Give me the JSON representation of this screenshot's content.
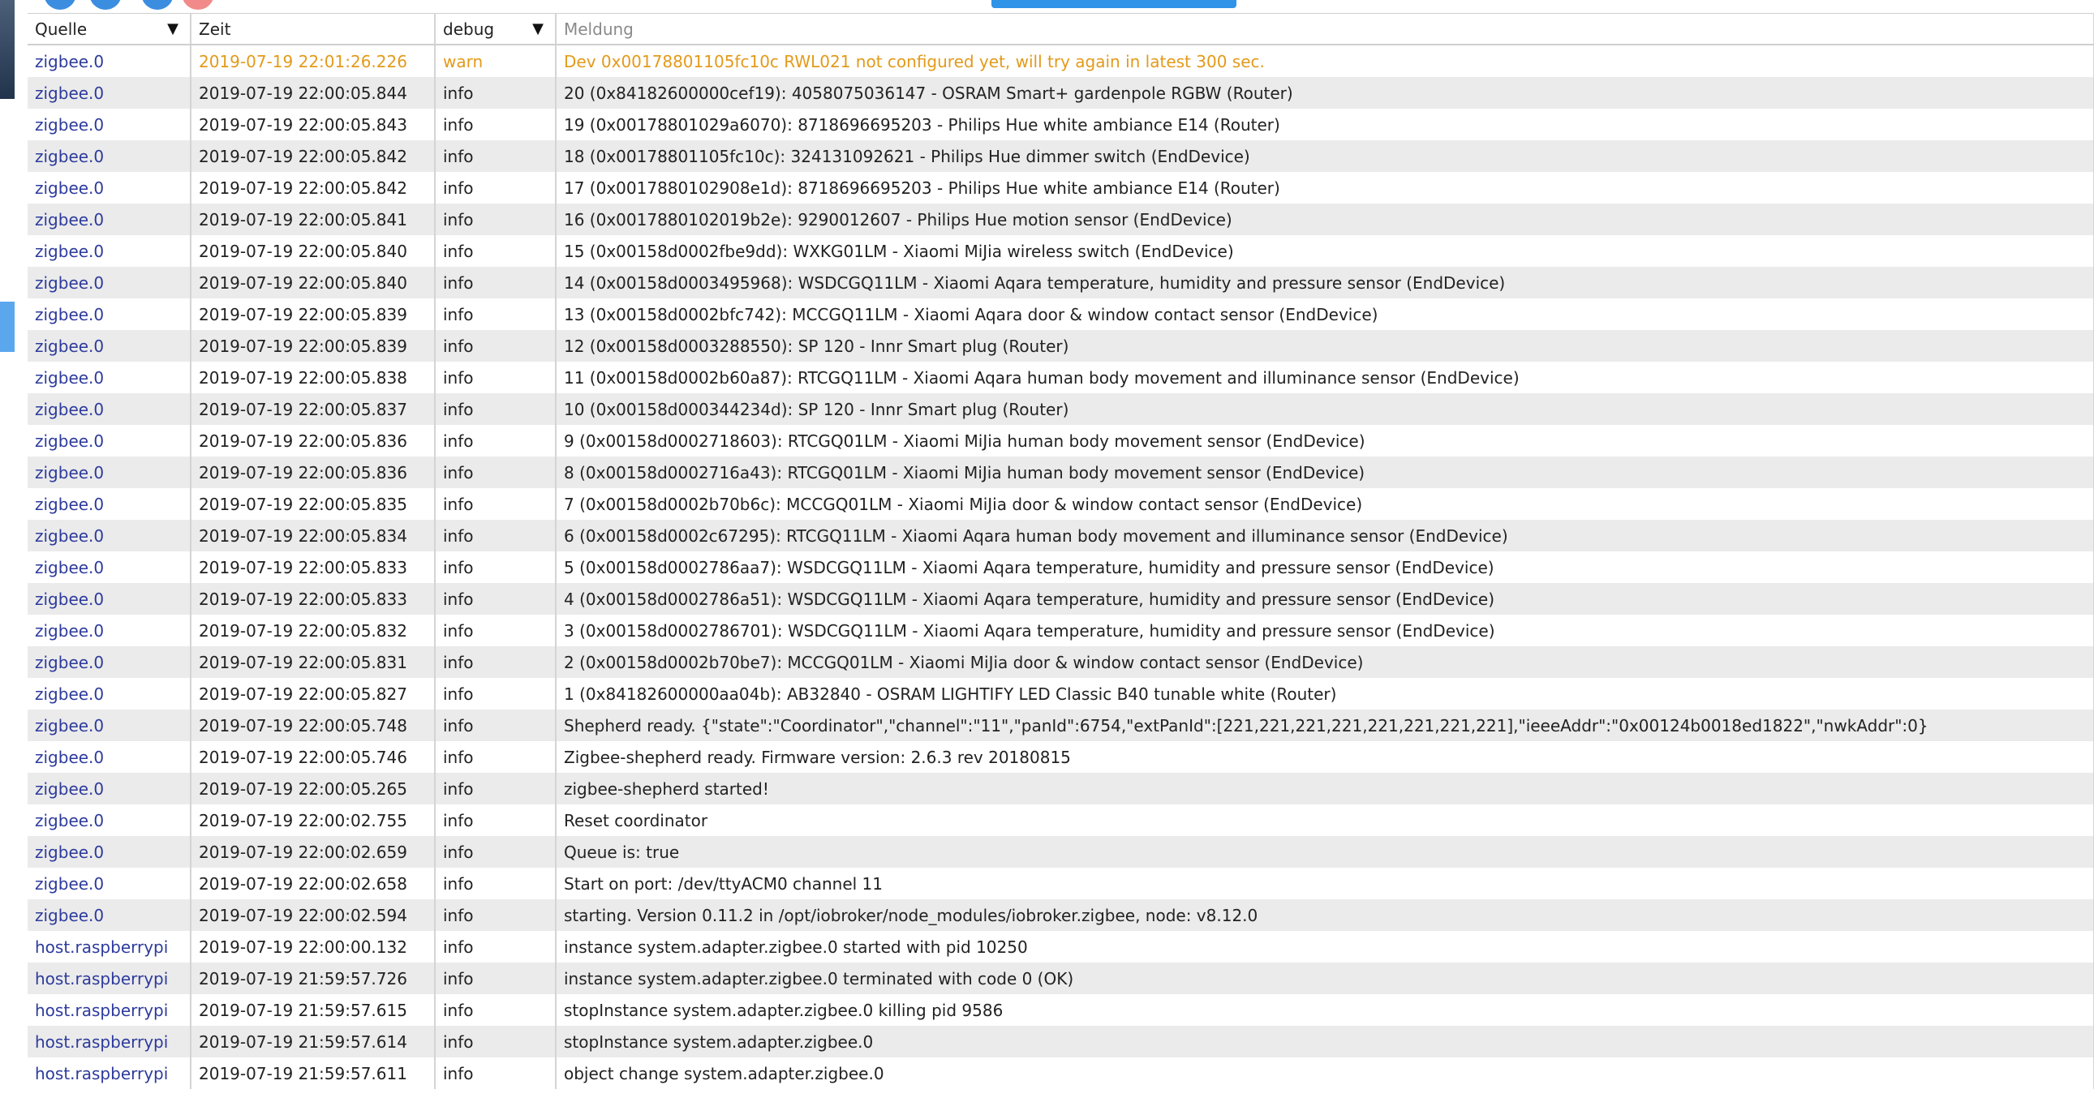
{
  "header": {
    "source": "Quelle",
    "time": "Zeit",
    "severity_filter": "debug",
    "message": "Meldung",
    "sort_arrow": "▼",
    "filter_arrow": "▼"
  },
  "colors": {
    "warn_text": "#e39a1a",
    "source_link": "#2d3b9c",
    "row_alt": "#ebebeb",
    "accent_blue": "#2f93e8"
  },
  "rows": [
    {
      "source": "zigbee.0",
      "time": "2019-07-19 22:01:26.226",
      "severity": "warn",
      "message": "Dev 0x00178801105fc10c RWL021 not configured yet, will try again in latest 300 sec."
    },
    {
      "source": "zigbee.0",
      "time": "2019-07-19 22:00:05.844",
      "severity": "info",
      "message": "20 (0x84182600000cef19): 4058075036147 - OSRAM Smart+ gardenpole RGBW (Router)"
    },
    {
      "source": "zigbee.0",
      "time": "2019-07-19 22:00:05.843",
      "severity": "info",
      "message": "19 (0x00178801029a6070): 8718696695203 - Philips Hue white ambiance E14 (Router)"
    },
    {
      "source": "zigbee.0",
      "time": "2019-07-19 22:00:05.842",
      "severity": "info",
      "message": "18 (0x00178801105fc10c): 324131092621 - Philips Hue dimmer switch (EndDevice)"
    },
    {
      "source": "zigbee.0",
      "time": "2019-07-19 22:00:05.842",
      "severity": "info",
      "message": "17 (0x0017880102908e1d): 8718696695203 - Philips Hue white ambiance E14 (Router)"
    },
    {
      "source": "zigbee.0",
      "time": "2019-07-19 22:00:05.841",
      "severity": "info",
      "message": "16 (0x0017880102019b2e): 9290012607 - Philips Hue motion sensor (EndDevice)"
    },
    {
      "source": "zigbee.0",
      "time": "2019-07-19 22:00:05.840",
      "severity": "info",
      "message": "15 (0x00158d0002fbe9dd): WXKG01LM - Xiaomi MiJia wireless switch (EndDevice)"
    },
    {
      "source": "zigbee.0",
      "time": "2019-07-19 22:00:05.840",
      "severity": "info",
      "message": "14 (0x00158d0003495968): WSDCGQ11LM - Xiaomi Aqara temperature, humidity and pressure sensor (EndDevice)"
    },
    {
      "source": "zigbee.0",
      "time": "2019-07-19 22:00:05.839",
      "severity": "info",
      "message": "13 (0x00158d0002bfc742): MCCGQ11LM - Xiaomi Aqara door & window contact sensor (EndDevice)"
    },
    {
      "source": "zigbee.0",
      "time": "2019-07-19 22:00:05.839",
      "severity": "info",
      "message": "12 (0x00158d0003288550): SP 120 - Innr Smart plug (Router)"
    },
    {
      "source": "zigbee.0",
      "time": "2019-07-19 22:00:05.838",
      "severity": "info",
      "message": "11 (0x00158d0002b60a87): RTCGQ11LM - Xiaomi Aqara human body movement and illuminance sensor (EndDevice)"
    },
    {
      "source": "zigbee.0",
      "time": "2019-07-19 22:00:05.837",
      "severity": "info",
      "message": "10 (0x00158d000344234d): SP 120 - Innr Smart plug (Router)"
    },
    {
      "source": "zigbee.0",
      "time": "2019-07-19 22:00:05.836",
      "severity": "info",
      "message": "9 (0x00158d0002718603): RTCGQ01LM - Xiaomi MiJia human body movement sensor (EndDevice)"
    },
    {
      "source": "zigbee.0",
      "time": "2019-07-19 22:00:05.836",
      "severity": "info",
      "message": "8 (0x00158d0002716a43): RTCGQ01LM - Xiaomi MiJia human body movement sensor (EndDevice)"
    },
    {
      "source": "zigbee.0",
      "time": "2019-07-19 22:00:05.835",
      "severity": "info",
      "message": "7 (0x00158d0002b70b6c): MCCGQ01LM - Xiaomi MiJia door & window contact sensor (EndDevice)"
    },
    {
      "source": "zigbee.0",
      "time": "2019-07-19 22:00:05.834",
      "severity": "info",
      "message": "6 (0x00158d0002c67295): RTCGQ11LM - Xiaomi Aqara human body movement and illuminance sensor (EndDevice)"
    },
    {
      "source": "zigbee.0",
      "time": "2019-07-19 22:00:05.833",
      "severity": "info",
      "message": "5 (0x00158d0002786aa7): WSDCGQ11LM - Xiaomi Aqara temperature, humidity and pressure sensor (EndDevice)"
    },
    {
      "source": "zigbee.0",
      "time": "2019-07-19 22:00:05.833",
      "severity": "info",
      "message": "4 (0x00158d0002786a51): WSDCGQ11LM - Xiaomi Aqara temperature, humidity and pressure sensor (EndDevice)"
    },
    {
      "source": "zigbee.0",
      "time": "2019-07-19 22:00:05.832",
      "severity": "info",
      "message": "3 (0x00158d0002786701): WSDCGQ11LM - Xiaomi Aqara temperature, humidity and pressure sensor (EndDevice)"
    },
    {
      "source": "zigbee.0",
      "time": "2019-07-19 22:00:05.831",
      "severity": "info",
      "message": "2 (0x00158d0002b70be7): MCCGQ01LM - Xiaomi MiJia door & window contact sensor (EndDevice)"
    },
    {
      "source": "zigbee.0",
      "time": "2019-07-19 22:00:05.827",
      "severity": "info",
      "message": "1 (0x84182600000aa04b): AB32840 - OSRAM LIGHTIFY LED Classic B40 tunable white (Router)"
    },
    {
      "source": "zigbee.0",
      "time": "2019-07-19 22:00:05.748",
      "severity": "info",
      "message": "Shepherd ready. {\"state\":\"Coordinator\",\"channel\":\"11\",\"panId\":6754,\"extPanId\":[221,221,221,221,221,221,221,221],\"ieeeAddr\":\"0x00124b0018ed1822\",\"nwkAddr\":0}"
    },
    {
      "source": "zigbee.0",
      "time": "2019-07-19 22:00:05.746",
      "severity": "info",
      "message": "Zigbee-shepherd ready. Firmware version: 2.6.3 rev 20180815"
    },
    {
      "source": "zigbee.0",
      "time": "2019-07-19 22:00:05.265",
      "severity": "info",
      "message": "zigbee-shepherd started!"
    },
    {
      "source": "zigbee.0",
      "time": "2019-07-19 22:00:02.755",
      "severity": "info",
      "message": "Reset coordinator"
    },
    {
      "source": "zigbee.0",
      "time": "2019-07-19 22:00:02.659",
      "severity": "info",
      "message": "Queue is: true"
    },
    {
      "source": "zigbee.0",
      "time": "2019-07-19 22:00:02.658",
      "severity": "info",
      "message": "Start on port: /dev/ttyACM0 channel 11"
    },
    {
      "source": "zigbee.0",
      "time": "2019-07-19 22:00:02.594",
      "severity": "info",
      "message": "starting. Version 0.11.2 in /opt/iobroker/node_modules/iobroker.zigbee, node: v8.12.0"
    },
    {
      "source": "host.raspberrypi",
      "time": "2019-07-19 22:00:00.132",
      "severity": "info",
      "message": "instance system.adapter.zigbee.0 started with pid 10250"
    },
    {
      "source": "host.raspberrypi",
      "time": "2019-07-19 21:59:57.726",
      "severity": "info",
      "message": "instance system.adapter.zigbee.0 terminated with code 0 (OK)"
    },
    {
      "source": "host.raspberrypi",
      "time": "2019-07-19 21:59:57.615",
      "severity": "info",
      "message": "stopInstance system.adapter.zigbee.0 killing pid 9586"
    },
    {
      "source": "host.raspberrypi",
      "time": "2019-07-19 21:59:57.614",
      "severity": "info",
      "message": "stopInstance system.adapter.zigbee.0"
    },
    {
      "source": "host.raspberrypi",
      "time": "2019-07-19 21:59:57.611",
      "severity": "info",
      "message": "object change system.adapter.zigbee.0"
    }
  ]
}
